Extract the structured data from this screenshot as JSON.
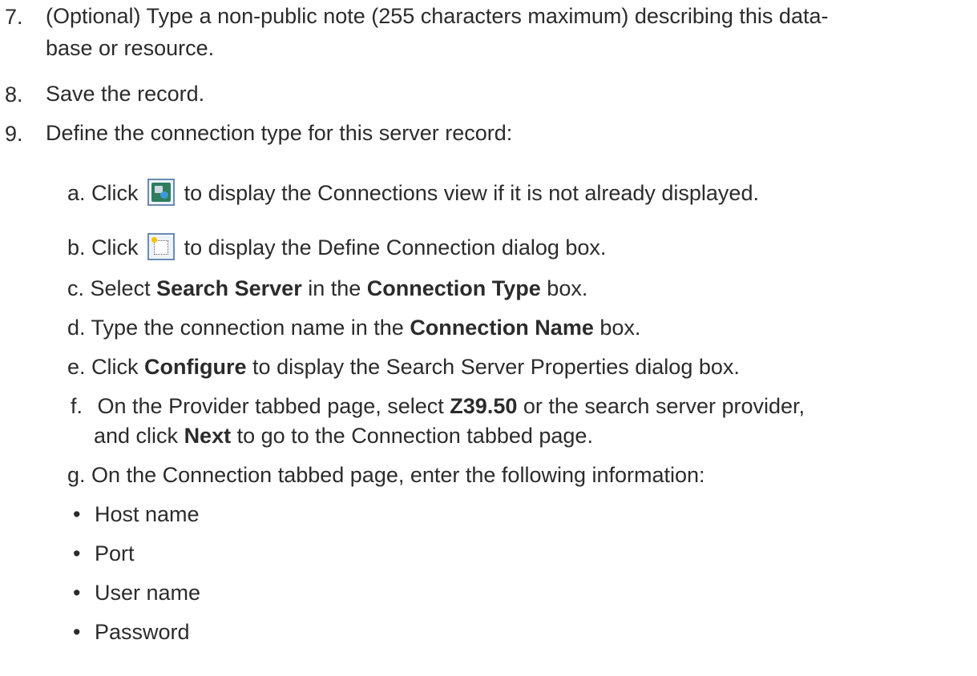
{
  "steps": {
    "s7": {
      "num": "7.",
      "line1": "(Optional) Type a non-public note (255 characters maximum) describing this data-",
      "line2": "base or resource."
    },
    "s8": {
      "num": "8.",
      "text": "Save the record."
    },
    "s9": {
      "num": "9.",
      "text": "Define the connection type for this server record:"
    }
  },
  "substeps": {
    "a": {
      "letter": "a.",
      "pre": "Click",
      "icon": "connections-view-icon",
      "post": "to display the Connections view if it is not already displayed."
    },
    "b": {
      "letter": "b.",
      "pre": "Click",
      "icon": "define-connection-icon",
      "post": "to display the Define Connection dialog box."
    },
    "c": {
      "letter": "c.",
      "pre": "Select ",
      "bold1": "Search Server",
      "mid": " in the ",
      "bold2": "Connection Type",
      "post": " box."
    },
    "d": {
      "letter": "d.",
      "pre": "Type the connection name in the ",
      "bold1": "Connection Name",
      "post": " box."
    },
    "e": {
      "letter": "e.",
      "pre": "Click ",
      "bold1": "Configure",
      "post": " to display the Search Server Properties dialog box."
    },
    "f": {
      "letter": "f.",
      "pre": "On the Provider tabbed page, select ",
      "bold1": "Z39.50",
      "post": " or the search server provider,",
      "line2_pre": "and click ",
      "line2_bold": "Next",
      "line2_post": " to go to the Connection tabbed page."
    },
    "g": {
      "letter": "g.",
      "text": "On the Connection tabbed page, enter the following information:"
    }
  },
  "bullets": [
    "Host name",
    "Port",
    "User name",
    "Password"
  ],
  "bullet_char": "•"
}
